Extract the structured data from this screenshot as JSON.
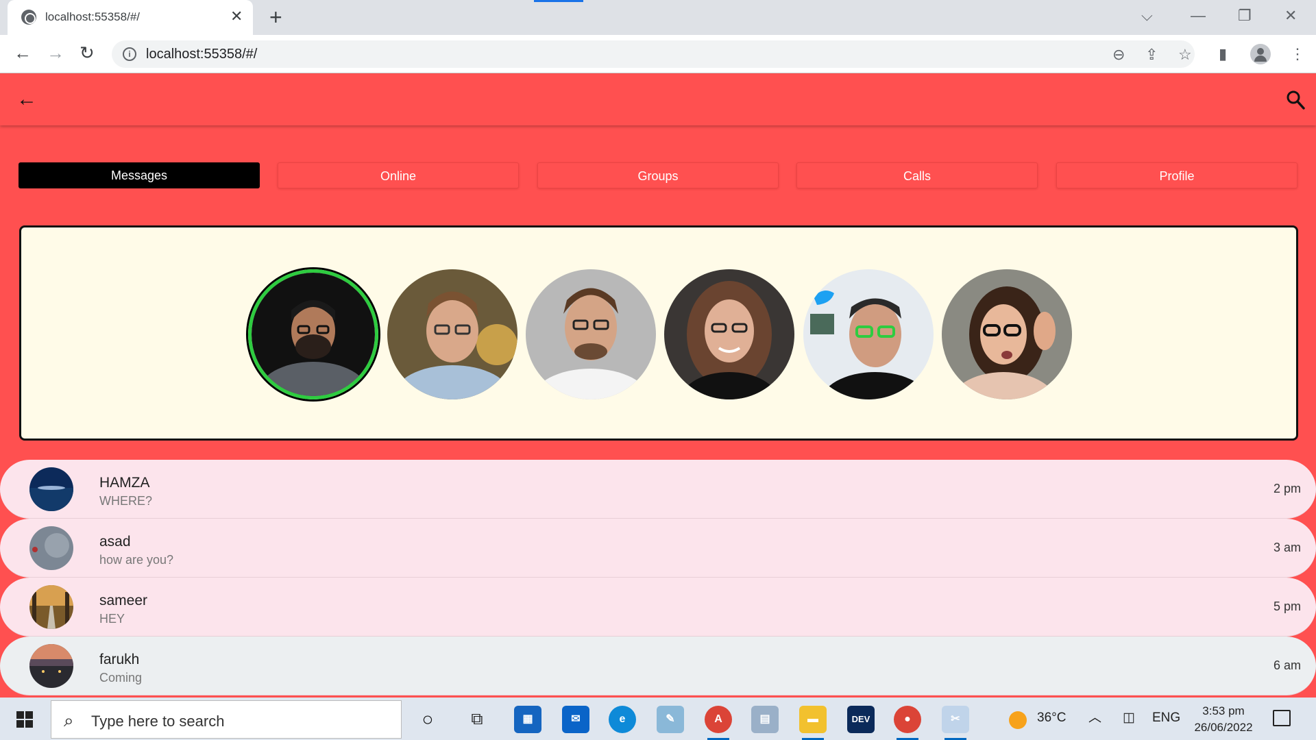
{
  "browser": {
    "tab_title": "localhost:55358/#/",
    "url": "localhost:55358/#/",
    "new_tab_label": "+",
    "close_tab_label": "✕"
  },
  "app": {
    "accent_color": "#ff5050",
    "back_icon": "arrow-left-icon",
    "search_icon": "search-icon",
    "tabs": [
      {
        "label": "Messages",
        "active": true
      },
      {
        "label": "Online",
        "active": false
      },
      {
        "label": "Groups",
        "active": false
      },
      {
        "label": "Calls",
        "active": false
      },
      {
        "label": "Profile",
        "active": false
      }
    ],
    "chats": [
      {
        "name": "HAMZA",
        "message": "WHERE?",
        "time": "2 pm"
      },
      {
        "name": "asad",
        "message": "how are you?",
        "time": "3 am"
      },
      {
        "name": "sameer",
        "message": "HEY",
        "time": "5 pm"
      },
      {
        "name": "farukh",
        "message": "Coming",
        "time": "6 am"
      }
    ]
  },
  "taskbar": {
    "search_placeholder": "Type here to search",
    "weather": "36°C",
    "language": "ENG",
    "time": "3:53 pm",
    "date": "26/06/2022"
  }
}
